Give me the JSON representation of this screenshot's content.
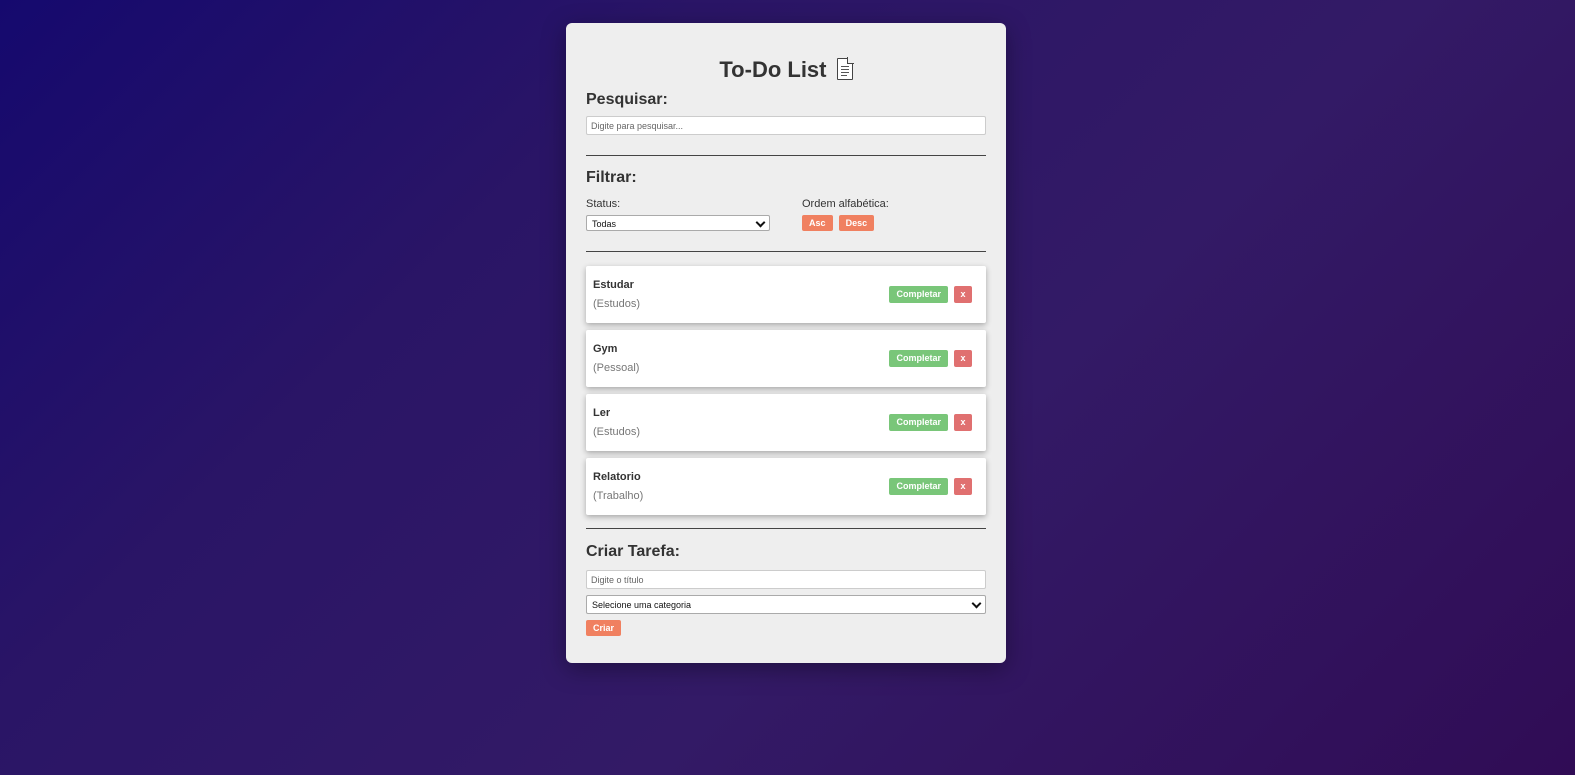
{
  "app": {
    "title": "To-Do List"
  },
  "search": {
    "heading": "Pesquisar:",
    "placeholder": "Digite para pesquisar...",
    "value": ""
  },
  "filter": {
    "heading": "Filtrar:",
    "status_label": "Status:",
    "status_selected": "Todas",
    "order_label": "Ordem alfabética:",
    "asc_label": "Asc",
    "desc_label": "Desc"
  },
  "tasks": [
    {
      "title": "Estudar",
      "category": "(Estudos)",
      "complete_label": "Completar",
      "remove_label": "x"
    },
    {
      "title": "Gym",
      "category": "(Pessoal)",
      "complete_label": "Completar",
      "remove_label": "x"
    },
    {
      "title": "Ler",
      "category": "(Estudos)",
      "complete_label": "Completar",
      "remove_label": "x"
    },
    {
      "title": "Relatorio",
      "category": "(Trabalho)",
      "complete_label": "Completar",
      "remove_label": "x"
    }
  ],
  "create": {
    "heading": "Criar Tarefa:",
    "title_placeholder": "Digite o título",
    "category_selected": "Selecione uma categoria",
    "submit_label": "Criar"
  },
  "colors": {
    "accent_orange": "#f08060",
    "complete_green": "#79c679",
    "remove_red": "#e07070",
    "panel_bg": "#eeeeee"
  }
}
